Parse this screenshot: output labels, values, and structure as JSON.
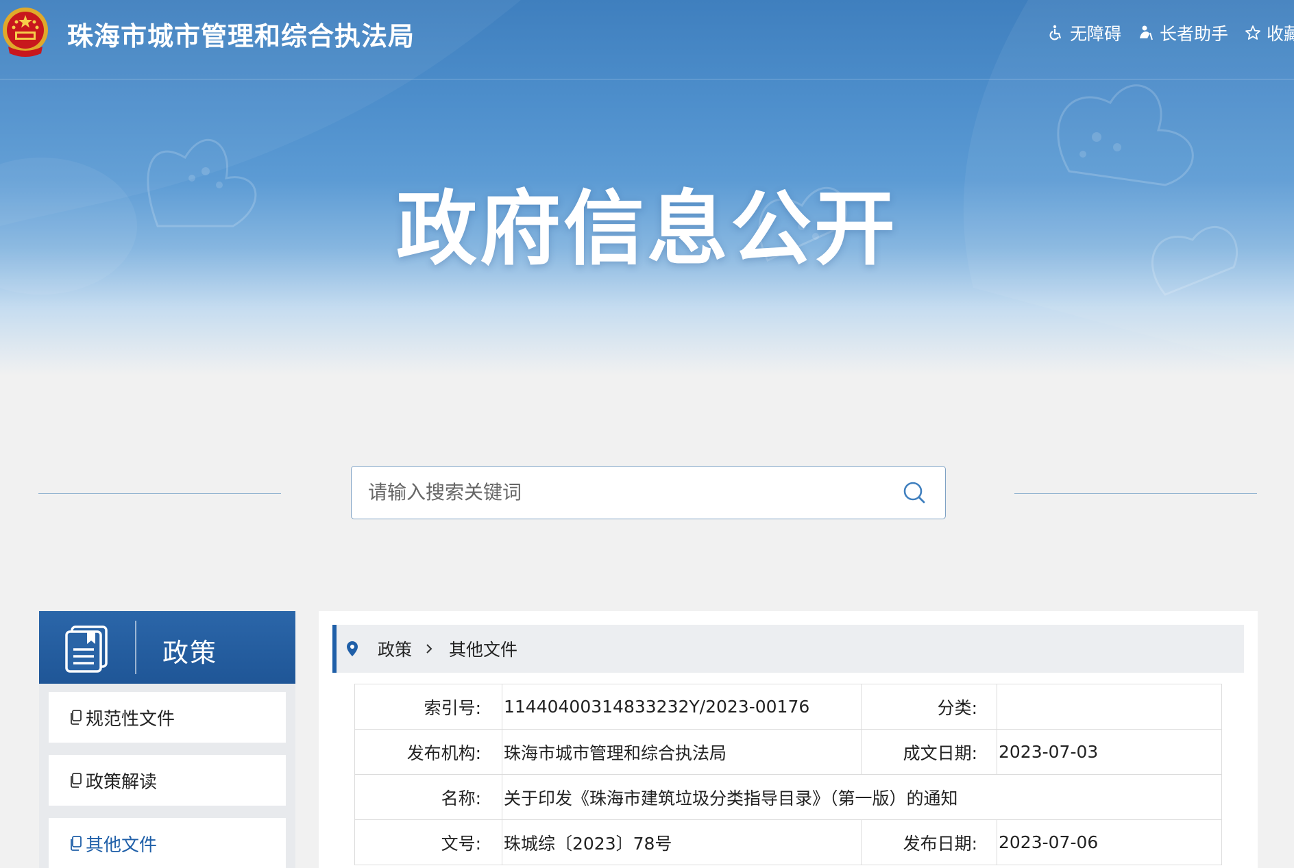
{
  "header": {
    "site_title": "珠海市城市管理和综合执法局",
    "links": [
      {
        "label": "无障碍",
        "icon": "accessibility-icon"
      },
      {
        "label": "长者助手",
        "icon": "elder-helper-icon"
      },
      {
        "label": "收藏",
        "icon": "star-icon"
      }
    ]
  },
  "hero": {
    "title": "政府信息公开"
  },
  "search": {
    "placeholder": "请输入搜索关键词",
    "value": ""
  },
  "sidebar": {
    "title": "政策",
    "items": [
      {
        "label": "规范性文件"
      },
      {
        "label": "政策解读"
      },
      {
        "label": "其他文件",
        "active": true
      }
    ]
  },
  "breadcrumb": {
    "items": [
      "政策",
      "其他文件"
    ]
  },
  "info": {
    "index_label": "索引号:",
    "index_value": "11440400314833232Y/2023-00176",
    "category_label": "分类:",
    "category_value": "",
    "publisher_label": "发布机构:",
    "publisher_value": "珠海市城市管理和综合执法局",
    "created_label": "成文日期:",
    "created_value": "2023-07-03",
    "name_label": "名称:",
    "name_value": "关于印发《珠海市建筑垃圾分类指导目录》（第一版）的通知",
    "docno_label": "文号:",
    "docno_value": "珠城综〔2023〕78号",
    "published_label": "发布日期:",
    "published_value": "2023-07-06"
  },
  "colors": {
    "accent": "#1f5fa8",
    "banner_top": "#3f7fbe",
    "page_bg": "#f1f1f1"
  }
}
